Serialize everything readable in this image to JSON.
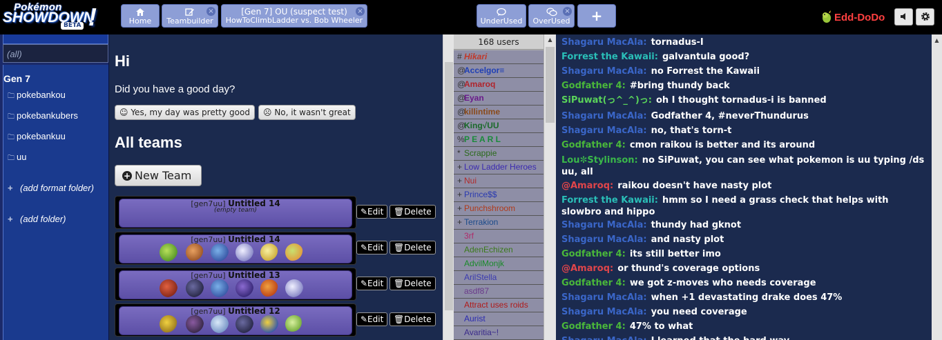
{
  "header": {
    "logo": {
      "line1": "Pokémon",
      "line2": "SHOWDOWN",
      "badge": "BETA",
      "bang": "!"
    },
    "tabs": [
      {
        "icon": "home-icon",
        "label": "Home"
      },
      {
        "icon": "edit-icon",
        "label": "Teambuilder",
        "close": "×"
      },
      {
        "line1": "[Gen 7] OU (suspect test)",
        "line2": "HowToClimbLadder vs. Bob Wheeler",
        "close": "×"
      },
      {
        "icon": "chat-icon",
        "label": "UnderUsed"
      },
      {
        "icon": "chat-icon",
        "label": "OverUsed",
        "close": "×"
      },
      {
        "label": "+"
      }
    ],
    "username": "Edd-DoDo",
    "sound_icon": "volume-icon",
    "settings_icon": "gear-icon"
  },
  "folders": {
    "filter": "(all)",
    "gen_title": "Gen 7",
    "items": [
      "pokebankou",
      "pokebankubers",
      "pokebankuu",
      "uu"
    ],
    "add_format_folder": "(add format folder)",
    "add_folder": "(add folder)"
  },
  "teambuilder": {
    "greeting": "Hi",
    "question": "Did you have a good day?",
    "yes_label": "☺ Yes, my day was pretty good",
    "no_label": "☹ No, it wasn't great",
    "all_teams": "All teams",
    "new_team": "New Team",
    "teams": [
      {
        "format": "[gen7uu]",
        "name": "Untitled 14",
        "empty": "(empty team)"
      },
      {
        "format": "[gen7uu]",
        "name": "Untitled 14",
        "empty": ""
      },
      {
        "format": "[gen7uu]",
        "name": "Untitled 13",
        "empty": ""
      },
      {
        "format": "[gen7uu]",
        "name": "Untitled 12",
        "empty": ""
      }
    ],
    "edit_label": "✎Edit",
    "delete_label": "🗑Delete"
  },
  "userlist": {
    "count": "168 users",
    "users": [
      {
        "rank": "#",
        "name": "Hikari",
        "color": "#c0392b",
        "style": "bold-italic"
      },
      {
        "rank": "@",
        "name": "Accelgor≡",
        "color": "#1f3fb5",
        "style": "bold"
      },
      {
        "rank": "@",
        "name": "Amaroq",
        "color": "#b0242c",
        "style": "bold"
      },
      {
        "rank": "@",
        "name": "Eyan",
        "color": "#6a1a8a",
        "style": "bold"
      },
      {
        "rank": "@",
        "name": "killintime",
        "color": "#8a4a1a",
        "style": "bold"
      },
      {
        "rank": "@",
        "name": "King√UU",
        "color": "#1a6a2a",
        "style": "bold"
      },
      {
        "rank": "%",
        "name": "P E A R L",
        "color": "#1a8a3a",
        "style": "bold"
      },
      {
        "rank": "*",
        "name": "Scrappie",
        "color": "#2a6a1a",
        "style": "normal"
      },
      {
        "rank": "+",
        "name": "Low Ladder Heroes",
        "color": "#3a2ab0",
        "style": "normal"
      },
      {
        "rank": "+",
        "name": "Nui",
        "color": "#b02a2a",
        "style": "normal"
      },
      {
        "rank": "+",
        "name": "Prince$$",
        "color": "#2a3ab0",
        "style": "normal"
      },
      {
        "rank": "+",
        "name": "Punchshroom",
        "color": "#b03a1a",
        "style": "normal"
      },
      {
        "rank": "+",
        "name": "Terrakion",
        "color": "#1a4a8a",
        "style": "normal"
      },
      {
        "rank": "",
        "name": "3rf",
        "color": "#b02a6a",
        "style": "normal"
      },
      {
        "rank": "",
        "name": "AdenEchizen",
        "color": "#3a7a1a",
        "style": "normal"
      },
      {
        "rank": "",
        "name": "AdvilMonjk",
        "color": "#1a8a2a",
        "style": "normal"
      },
      {
        "rank": "",
        "name": "ArilStella",
        "color": "#3a3ab0",
        "style": "normal"
      },
      {
        "rank": "",
        "name": "asdf87",
        "color": "#6a3a8a",
        "style": "normal"
      },
      {
        "rank": "",
        "name": "Attract uses roids",
        "color": "#b01a1a",
        "style": "normal"
      },
      {
        "rank": "",
        "name": "Aurist",
        "color": "#2a2ab0",
        "style": "normal"
      },
      {
        "rank": "",
        "name": "Avaritia~!",
        "color": "#3a2a8a",
        "style": "normal"
      }
    ]
  },
  "chat": {
    "messages": [
      {
        "user": "Shagaru MacAla:",
        "color": "#3a66c8",
        "text": "tornadus-I"
      },
      {
        "user": "Forrest the Kawaii:",
        "color": "#2abfb8",
        "text": "galvantula good?"
      },
      {
        "user": "Shagaru MacAla:",
        "color": "#3a66c8",
        "text": "no Forrest the Kawaii"
      },
      {
        "user": "Godfather 4:",
        "color": "#4ab83a",
        "text": "#bring thundy back"
      },
      {
        "user": "SiPuwat(っ^_^)っ:",
        "color": "#5ad35a",
        "text": "oh I thought tornadus-i is banned"
      },
      {
        "user": "Shagaru MacAla:",
        "color": "#3a66c8",
        "text": "Godfather 4, #neverThundurus"
      },
      {
        "user": "Shagaru MacAla:",
        "color": "#3a66c8",
        "text": "no, that's torn-t"
      },
      {
        "user": "Godfather 4:",
        "color": "#4ab83a",
        "text": "cmon raikou is better and its around"
      },
      {
        "user": "Lou✼Stylinson:",
        "color": "#3ab84a",
        "text": "no SiPuwat, you can see what pokemon is uu typing /ds uu, all"
      },
      {
        "user": "@Amaroq:",
        "color": "#e0454a",
        "text": "raikou doesn't have nasty plot"
      },
      {
        "user": "Forrest the Kawaii:",
        "color": "#2abfb8",
        "text": "hmm so I need a grass check that helps with slowbro and hippo"
      },
      {
        "user": "Shagaru MacAla:",
        "color": "#3a66c8",
        "text": "thundy had gknot"
      },
      {
        "user": "Shagaru MacAla:",
        "color": "#3a66c8",
        "text": "and nasty plot"
      },
      {
        "user": "Godfather 4:",
        "color": "#4ab83a",
        "text": "its still better imo"
      },
      {
        "user": "@Amaroq:",
        "color": "#e0454a",
        "text": "or thund's coverage options"
      },
      {
        "user": "Godfather 4:",
        "color": "#4ab83a",
        "text": "we got z-moves who needs coverage"
      },
      {
        "user": "Shagaru MacAla:",
        "color": "#3a66c8",
        "text": "when +1 devastating drake does 47%"
      },
      {
        "user": "Shagaru MacAla:",
        "color": "#3a66c8",
        "text": "you need coverage"
      },
      {
        "user": "Godfather 4:",
        "color": "#4ab83a",
        "text": "47% to what"
      },
      {
        "user": "Shagaru MacAla:",
        "color": "#3a66c8",
        "text": "I learned that the hard way"
      }
    ]
  }
}
